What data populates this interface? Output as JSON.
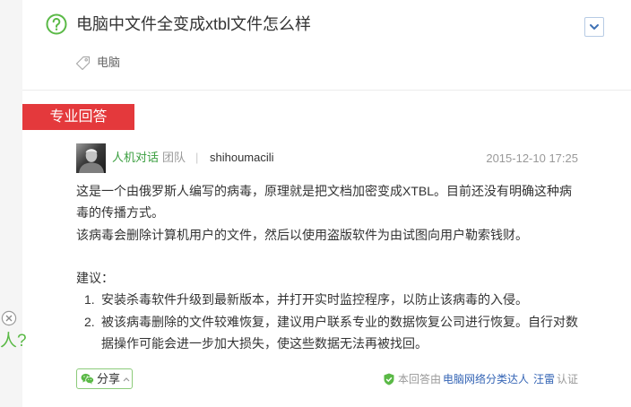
{
  "colors": {
    "accent_green": "#5ab946",
    "author_green": "#3a9e3f",
    "label_red": "#e4393c",
    "link_blue": "#3565b5",
    "expand_blue": "#3f72b5"
  },
  "icons": {
    "question": "question-mark-icon",
    "expand": "chevron-down-icon",
    "tag": "tag-icon",
    "share": "wechat-icon",
    "share_more": "chevron-up-icon",
    "certified": "shield-check-icon",
    "close": "close-icon"
  },
  "question": {
    "title": "电脑中文件全变成xtbl文件怎么样",
    "tags": [
      "电脑"
    ]
  },
  "answer": {
    "label": "专业回答",
    "author": {
      "name": "人机对话",
      "type": "团队",
      "separator": "|",
      "username": "shihoumacili"
    },
    "date": "2015-12-10 17:25",
    "paragraphs": [
      "这是一个由俄罗斯人编写的病毒，原理就是把文档加密变成XTBL。目前还没有明确这种病毒的传播方式。",
      "该病毒会删除计算机用户的文件，然后以使用盗版软件为由试图向用户勒索钱财。"
    ],
    "suggestion_heading": "建议：",
    "suggestions": [
      {
        "number": "1.",
        "text": "安装杀毒软件升级到最新版本，并打开实时监控程序，以防止该病毒的入侵。"
      },
      {
        "number": "2.",
        "text": "被该病毒删除的文件较难恢复，建议用户联系专业的数据恢复公司进行恢复。自行对数据操作可能会进一步加大损失，使这些数据无法再被找回。"
      }
    ]
  },
  "footer": {
    "share_label": "分享",
    "cert_prefix": "本回答由",
    "cert_category": "电脑网络分类达人",
    "cert_name": "汪雷",
    "cert_suffix": "认证"
  },
  "side_widget": {
    "label": "人?"
  }
}
